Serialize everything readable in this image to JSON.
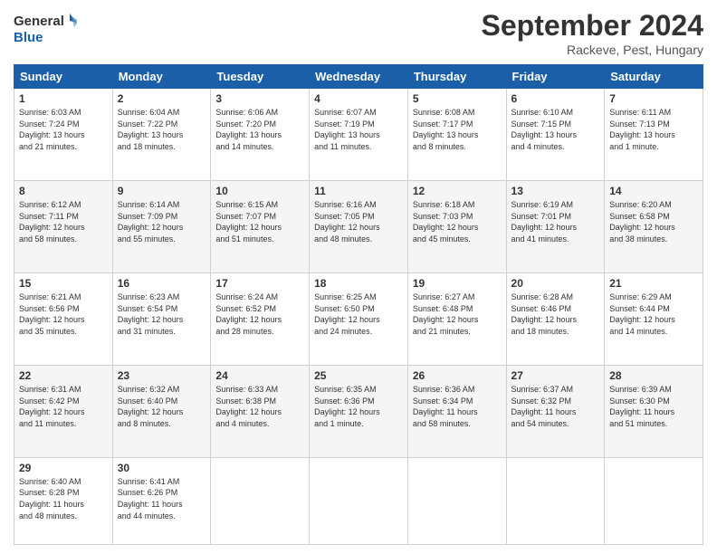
{
  "header": {
    "logo_line1": "General",
    "logo_line2": "Blue",
    "month": "September 2024",
    "location": "Rackeve, Pest, Hungary"
  },
  "columns": [
    "Sunday",
    "Monday",
    "Tuesday",
    "Wednesday",
    "Thursday",
    "Friday",
    "Saturday"
  ],
  "weeks": [
    [
      {
        "day": "1",
        "text": "Sunrise: 6:03 AM\nSunset: 7:24 PM\nDaylight: 13 hours\nand 21 minutes."
      },
      {
        "day": "2",
        "text": "Sunrise: 6:04 AM\nSunset: 7:22 PM\nDaylight: 13 hours\nand 18 minutes."
      },
      {
        "day": "3",
        "text": "Sunrise: 6:06 AM\nSunset: 7:20 PM\nDaylight: 13 hours\nand 14 minutes."
      },
      {
        "day": "4",
        "text": "Sunrise: 6:07 AM\nSunset: 7:19 PM\nDaylight: 13 hours\nand 11 minutes."
      },
      {
        "day": "5",
        "text": "Sunrise: 6:08 AM\nSunset: 7:17 PM\nDaylight: 13 hours\nand 8 minutes."
      },
      {
        "day": "6",
        "text": "Sunrise: 6:10 AM\nSunset: 7:15 PM\nDaylight: 13 hours\nand 4 minutes."
      },
      {
        "day": "7",
        "text": "Sunrise: 6:11 AM\nSunset: 7:13 PM\nDaylight: 13 hours\nand 1 minute."
      }
    ],
    [
      {
        "day": "8",
        "text": "Sunrise: 6:12 AM\nSunset: 7:11 PM\nDaylight: 12 hours\nand 58 minutes."
      },
      {
        "day": "9",
        "text": "Sunrise: 6:14 AM\nSunset: 7:09 PM\nDaylight: 12 hours\nand 55 minutes."
      },
      {
        "day": "10",
        "text": "Sunrise: 6:15 AM\nSunset: 7:07 PM\nDaylight: 12 hours\nand 51 minutes."
      },
      {
        "day": "11",
        "text": "Sunrise: 6:16 AM\nSunset: 7:05 PM\nDaylight: 12 hours\nand 48 minutes."
      },
      {
        "day": "12",
        "text": "Sunrise: 6:18 AM\nSunset: 7:03 PM\nDaylight: 12 hours\nand 45 minutes."
      },
      {
        "day": "13",
        "text": "Sunrise: 6:19 AM\nSunset: 7:01 PM\nDaylight: 12 hours\nand 41 minutes."
      },
      {
        "day": "14",
        "text": "Sunrise: 6:20 AM\nSunset: 6:58 PM\nDaylight: 12 hours\nand 38 minutes."
      }
    ],
    [
      {
        "day": "15",
        "text": "Sunrise: 6:21 AM\nSunset: 6:56 PM\nDaylight: 12 hours\nand 35 minutes."
      },
      {
        "day": "16",
        "text": "Sunrise: 6:23 AM\nSunset: 6:54 PM\nDaylight: 12 hours\nand 31 minutes."
      },
      {
        "day": "17",
        "text": "Sunrise: 6:24 AM\nSunset: 6:52 PM\nDaylight: 12 hours\nand 28 minutes."
      },
      {
        "day": "18",
        "text": "Sunrise: 6:25 AM\nSunset: 6:50 PM\nDaylight: 12 hours\nand 24 minutes."
      },
      {
        "day": "19",
        "text": "Sunrise: 6:27 AM\nSunset: 6:48 PM\nDaylight: 12 hours\nand 21 minutes."
      },
      {
        "day": "20",
        "text": "Sunrise: 6:28 AM\nSunset: 6:46 PM\nDaylight: 12 hours\nand 18 minutes."
      },
      {
        "day": "21",
        "text": "Sunrise: 6:29 AM\nSunset: 6:44 PM\nDaylight: 12 hours\nand 14 minutes."
      }
    ],
    [
      {
        "day": "22",
        "text": "Sunrise: 6:31 AM\nSunset: 6:42 PM\nDaylight: 12 hours\nand 11 minutes."
      },
      {
        "day": "23",
        "text": "Sunrise: 6:32 AM\nSunset: 6:40 PM\nDaylight: 12 hours\nand 8 minutes."
      },
      {
        "day": "24",
        "text": "Sunrise: 6:33 AM\nSunset: 6:38 PM\nDaylight: 12 hours\nand 4 minutes."
      },
      {
        "day": "25",
        "text": "Sunrise: 6:35 AM\nSunset: 6:36 PM\nDaylight: 12 hours\nand 1 minute."
      },
      {
        "day": "26",
        "text": "Sunrise: 6:36 AM\nSunset: 6:34 PM\nDaylight: 11 hours\nand 58 minutes."
      },
      {
        "day": "27",
        "text": "Sunrise: 6:37 AM\nSunset: 6:32 PM\nDaylight: 11 hours\nand 54 minutes."
      },
      {
        "day": "28",
        "text": "Sunrise: 6:39 AM\nSunset: 6:30 PM\nDaylight: 11 hours\nand 51 minutes."
      }
    ],
    [
      {
        "day": "29",
        "text": "Sunrise: 6:40 AM\nSunset: 6:28 PM\nDaylight: 11 hours\nand 48 minutes."
      },
      {
        "day": "30",
        "text": "Sunrise: 6:41 AM\nSunset: 6:26 PM\nDaylight: 11 hours\nand 44 minutes."
      },
      {
        "day": "",
        "text": ""
      },
      {
        "day": "",
        "text": ""
      },
      {
        "day": "",
        "text": ""
      },
      {
        "day": "",
        "text": ""
      },
      {
        "day": "",
        "text": ""
      }
    ]
  ]
}
